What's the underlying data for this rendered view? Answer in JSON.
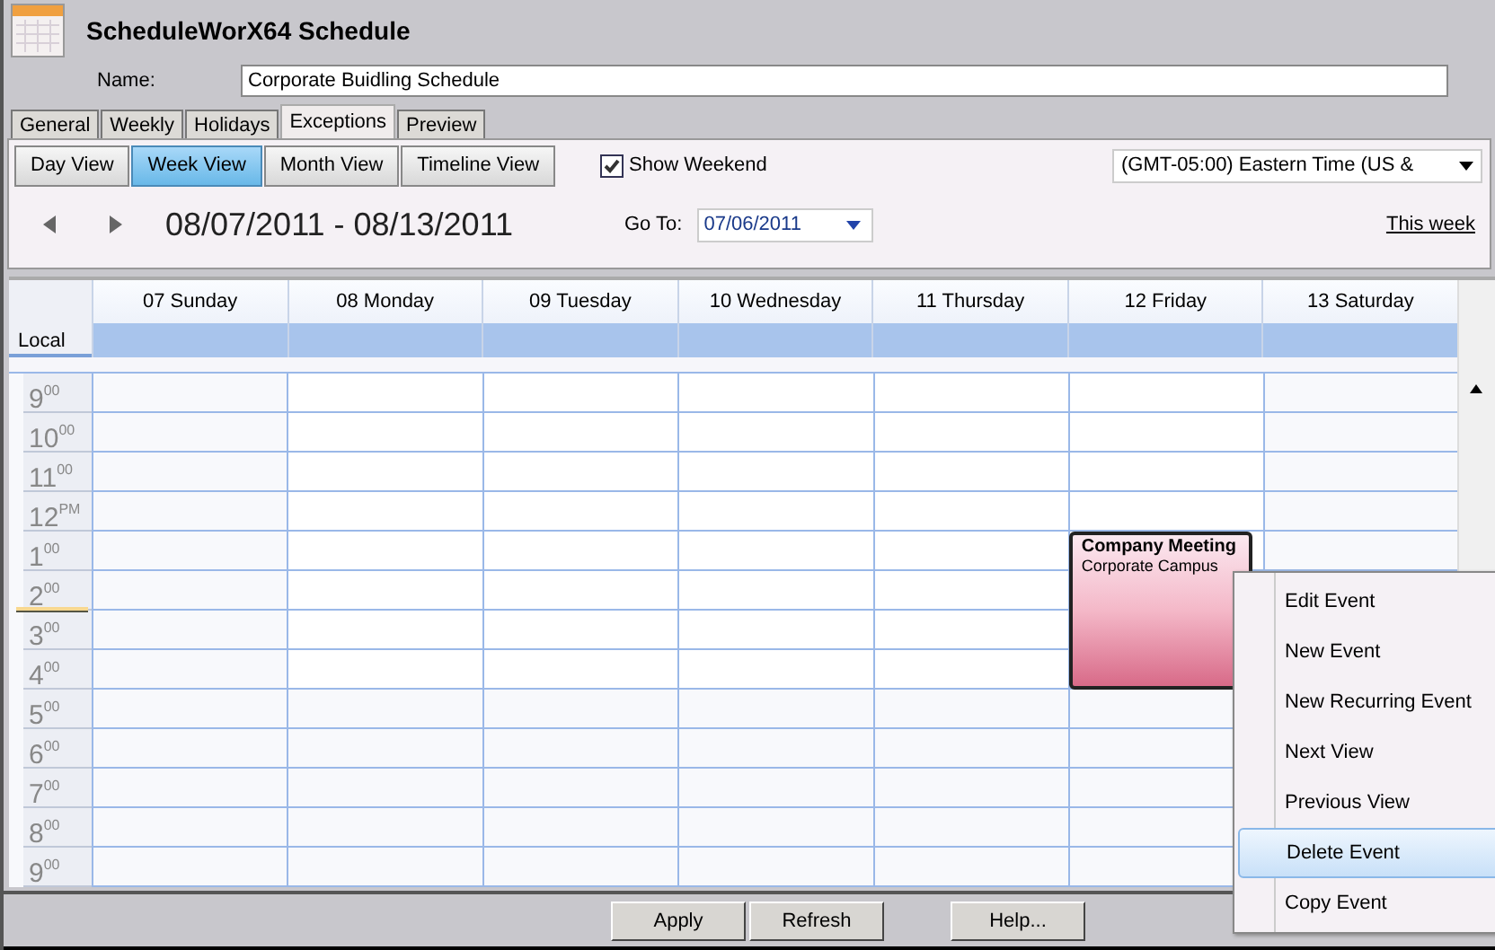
{
  "window": {
    "title": "ScheduleWorX64 Schedule"
  },
  "name_field": {
    "label": "Name:",
    "value": "Corporate Buidling Schedule"
  },
  "tabs": [
    {
      "label": "General",
      "selected": false
    },
    {
      "label": "Weekly",
      "selected": false
    },
    {
      "label": "Holidays",
      "selected": false
    },
    {
      "label": "Exceptions",
      "selected": true
    },
    {
      "label": "Preview",
      "selected": false
    }
  ],
  "view_buttons": [
    {
      "label": "Day View",
      "selected": false
    },
    {
      "label": "Week View",
      "selected": true
    },
    {
      "label": "Month View",
      "selected": false
    },
    {
      "label": "Timeline View",
      "selected": false
    }
  ],
  "show_weekend": {
    "label": "Show Weekend",
    "checked": true
  },
  "timezone": {
    "value": "(GMT-05:00) Eastern Time (US &"
  },
  "date_range": "08/07/2011 - 08/13/2011",
  "goto": {
    "label": "Go To:",
    "value": "07/06/2011"
  },
  "this_week_link": "This week",
  "calendar": {
    "local_label": "Local",
    "days": [
      {
        "label": "07 Sunday"
      },
      {
        "label": "08 Monday"
      },
      {
        "label": "09 Tuesday"
      },
      {
        "label": "10 Wednesday"
      },
      {
        "label": "11 Thursday"
      },
      {
        "label": "12 Friday",
        "events": [
          {
            "title": "Company Meeting",
            "location": "Corporate Campus"
          }
        ]
      },
      {
        "label": "13 Saturday"
      }
    ],
    "hours": [
      "9$^{00}$",
      "10$^{00}$",
      "11$^{00}$",
      "12$^{PM}$",
      "1$^{00}$",
      "2$^{00}$",
      "3$^{00}$",
      "4$^{00}$",
      "5$^{00}$",
      "6$^{00}$",
      "7$^{00}$",
      "8$^{00}$",
      "9$^{00}$"
    ]
  },
  "context_menu": [
    {
      "label": "Edit Event",
      "selected": false
    },
    {
      "label": "New Event",
      "selected": false
    },
    {
      "label": "New Recurring Event",
      "selected": false
    },
    {
      "label": "Next View",
      "selected": false
    },
    {
      "label": "Previous View",
      "selected": false
    },
    {
      "label": "Delete Event",
      "selected": true
    },
    {
      "label": "Copy Event",
      "selected": false
    }
  ],
  "footer_buttons": [
    "Apply",
    "Refresh",
    "Help..."
  ]
}
